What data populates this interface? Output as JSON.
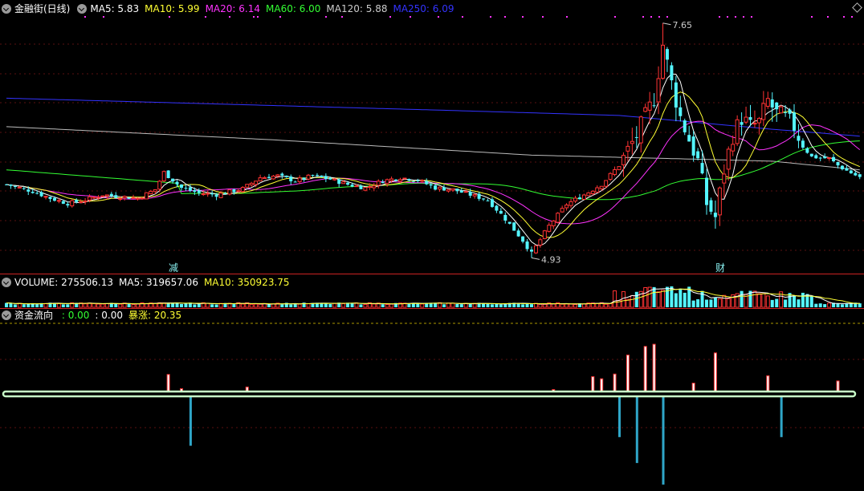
{
  "header": {
    "title": "金融街(日线)",
    "ma": [
      {
        "label": "MA5: 5.83",
        "color": "#ffffff"
      },
      {
        "label": "MA10: 5.99",
        "color": "#ffff33"
      },
      {
        "label": "MA20: 6.14",
        "color": "#ff33ff"
      },
      {
        "label": "MA60: 6.00",
        "color": "#33ff33"
      },
      {
        "label": "MA120: 5.88",
        "color": "#cccccc"
      },
      {
        "label": "MA250: 6.09",
        "color": "#3333ff"
      }
    ]
  },
  "volume_header": {
    "items": [
      {
        "label": "VOLUME: 275506.13",
        "color": "#ffffff"
      },
      {
        "label": "MA5: 319657.06",
        "color": "#ffffff"
      },
      {
        "label": "MA10: 350923.75",
        "color": "#ffff33"
      }
    ]
  },
  "flow_header": {
    "items": [
      {
        "label": "资金流向",
        "color": "#ffffff"
      },
      {
        "label": "  : 0.00",
        "color": "#33ff33"
      },
      {
        "label": ": 0.00",
        "color": "#ffffff"
      },
      {
        "label": "暴涨: 20.35",
        "color": "#ffff33"
      }
    ]
  },
  "markers": {
    "jian": "减",
    "cai": "财"
  },
  "chart_data": {
    "type": "candlestick",
    "price_range": [
      4.85,
      7.75
    ],
    "high_label": "7.65",
    "low_label": "4.93",
    "colors": {
      "up": "#ff3333",
      "down": "#54f5ff",
      "ma5": "#ffffff",
      "ma10": "#ffff33",
      "ma20": "#ff33ff",
      "ma60": "#33ff33",
      "ma120": "#bbbbbb",
      "ma250": "#3333ff",
      "flow_base": "#c8ffc8"
    },
    "volume_range": [
      0,
      1600000
    ],
    "flow_range": [
      -22,
      12
    ],
    "ma120_anchors": [
      [
        0,
        6.45
      ],
      [
        60,
        6.3
      ],
      [
        120,
        6.12
      ],
      [
        160,
        6.07
      ],
      [
        175,
        6.05
      ],
      [
        195,
        5.95
      ]
    ],
    "ma250_anchors": [
      [
        0,
        6.78
      ],
      [
        50,
        6.71
      ],
      [
        100,
        6.64
      ],
      [
        140,
        6.58
      ],
      [
        175,
        6.42
      ],
      [
        195,
        6.34
      ]
    ],
    "flow_bars": [
      [
        37,
        4.5
      ],
      [
        40,
        1.2
      ],
      [
        42,
        -12
      ],
      [
        55,
        1.6
      ],
      [
        106,
        0.4
      ],
      [
        125,
        1.0
      ],
      [
        134,
        4.0
      ],
      [
        136,
        3.5
      ],
      [
        139,
        4.6
      ],
      [
        140,
        -10
      ],
      [
        142,
        9.0
      ],
      [
        144,
        -16
      ],
      [
        146,
        11.0
      ],
      [
        148,
        11.5
      ],
      [
        150,
        -21
      ],
      [
        157,
        2.5
      ],
      [
        162,
        9.5
      ],
      [
        174,
        4.2
      ],
      [
        177,
        -10
      ],
      [
        190,
        3.0
      ]
    ]
  }
}
